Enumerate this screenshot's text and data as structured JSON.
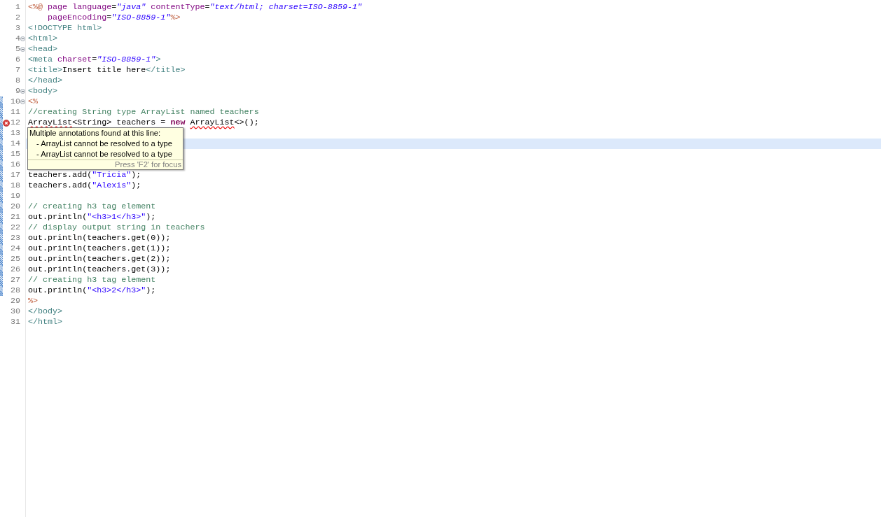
{
  "editor": {
    "lines": [
      {
        "number": "1",
        "fold_marker": false,
        "error": false,
        "changed": false,
        "current": false,
        "tokens": [
          {
            "kind": "delim",
            "text": "<%@"
          },
          {
            "kind": "attr",
            "text": " page language"
          },
          {
            "kind": "plain",
            "text": "="
          },
          {
            "kind": "string",
            "text": "\"java\""
          },
          {
            "kind": "attr",
            "text": " contentType"
          },
          {
            "kind": "plain",
            "text": "="
          },
          {
            "kind": "string",
            "text": "\"text/html; charset=ISO-8859-1\""
          }
        ]
      },
      {
        "number": "2",
        "fold_marker": false,
        "error": false,
        "changed": false,
        "current": false,
        "tokens": [
          {
            "kind": "attr",
            "text": "    pageEncoding"
          },
          {
            "kind": "plain",
            "text": "="
          },
          {
            "kind": "string",
            "text": "\"ISO-8859-1\""
          },
          {
            "kind": "delim",
            "text": "%>"
          }
        ]
      },
      {
        "number": "3",
        "fold_marker": false,
        "error": false,
        "changed": false,
        "current": false,
        "tokens": [
          {
            "kind": "tag",
            "text": "<!DOCTYPE html>"
          }
        ]
      },
      {
        "number": "4",
        "fold_marker": true,
        "error": false,
        "changed": false,
        "current": false,
        "tokens": [
          {
            "kind": "tag",
            "text": "<html>"
          }
        ]
      },
      {
        "number": "5",
        "fold_marker": true,
        "error": false,
        "changed": false,
        "current": false,
        "tokens": [
          {
            "kind": "tag",
            "text": "<head>"
          }
        ]
      },
      {
        "number": "6",
        "fold_marker": false,
        "error": false,
        "changed": false,
        "current": false,
        "tokens": [
          {
            "kind": "tag",
            "text": "<meta"
          },
          {
            "kind": "attr",
            "text": " charset"
          },
          {
            "kind": "plain",
            "text": "="
          },
          {
            "kind": "string",
            "text": "\"ISO-8859-1\""
          },
          {
            "kind": "tag",
            "text": ">"
          }
        ]
      },
      {
        "number": "7",
        "fold_marker": false,
        "error": false,
        "changed": false,
        "current": false,
        "tokens": [
          {
            "kind": "tag",
            "text": "<title>"
          },
          {
            "kind": "plain",
            "text": "Insert title here"
          },
          {
            "kind": "tag",
            "text": "</title>"
          }
        ]
      },
      {
        "number": "8",
        "fold_marker": false,
        "error": false,
        "changed": false,
        "current": false,
        "tokens": [
          {
            "kind": "tag",
            "text": "</head>"
          }
        ]
      },
      {
        "number": "9",
        "fold_marker": true,
        "error": false,
        "changed": false,
        "current": false,
        "tokens": [
          {
            "kind": "tag",
            "text": "<body>"
          }
        ]
      },
      {
        "number": "10",
        "fold_marker": true,
        "error": false,
        "changed": true,
        "current": false,
        "tokens": [
          {
            "kind": "delim",
            "text": "<%"
          }
        ]
      },
      {
        "number": "11",
        "fold_marker": false,
        "error": false,
        "changed": true,
        "current": false,
        "tokens": [
          {
            "kind": "comment",
            "text": "//creating String type ArrayList named teachers"
          }
        ]
      },
      {
        "number": "12",
        "fold_marker": false,
        "error": true,
        "changed": true,
        "current": false,
        "tokens": [
          {
            "kind": "error-type",
            "text": "ArrayList"
          },
          {
            "kind": "plain",
            "text": "<String> teachers = "
          },
          {
            "kind": "keyword",
            "text": "new "
          },
          {
            "kind": "error-type",
            "text": "ArrayList"
          },
          {
            "kind": "plain",
            "text": "<>();"
          }
        ]
      },
      {
        "number": "13",
        "fold_marker": false,
        "error": false,
        "changed": true,
        "current": false
      },
      {
        "number": "14",
        "fold_marker": false,
        "error": false,
        "changed": true,
        "current": true
      },
      {
        "number": "15",
        "fold_marker": false,
        "error": false,
        "changed": true,
        "current": false
      },
      {
        "number": "16",
        "fold_marker": false,
        "error": false,
        "changed": true,
        "current": false
      },
      {
        "number": "17",
        "fold_marker": false,
        "error": false,
        "changed": true,
        "current": false,
        "tokens": [
          {
            "kind": "plain",
            "text": "teachers.add("
          },
          {
            "kind": "jstring",
            "text": "\"Tricia\""
          },
          {
            "kind": "plain",
            "text": ");"
          }
        ]
      },
      {
        "number": "18",
        "fold_marker": false,
        "error": false,
        "changed": true,
        "current": false,
        "tokens": [
          {
            "kind": "plain",
            "text": "teachers.add("
          },
          {
            "kind": "jstring",
            "text": "\"Alexis\""
          },
          {
            "kind": "plain",
            "text": ");"
          }
        ]
      },
      {
        "number": "19",
        "fold_marker": false,
        "error": false,
        "changed": true,
        "current": false
      },
      {
        "number": "20",
        "fold_marker": false,
        "error": false,
        "changed": true,
        "current": false,
        "tokens": [
          {
            "kind": "comment",
            "text": "// creating h3 tag element"
          }
        ]
      },
      {
        "number": "21",
        "fold_marker": false,
        "error": false,
        "changed": true,
        "current": false,
        "tokens": [
          {
            "kind": "plain",
            "text": "out.println("
          },
          {
            "kind": "jstring",
            "text": "\"<h3>1</h3>\""
          },
          {
            "kind": "plain",
            "text": ");"
          }
        ]
      },
      {
        "number": "22",
        "fold_marker": false,
        "error": false,
        "changed": true,
        "current": false,
        "tokens": [
          {
            "kind": "comment",
            "text": "// display output string in teachers"
          }
        ]
      },
      {
        "number": "23",
        "fold_marker": false,
        "error": false,
        "changed": true,
        "current": false,
        "tokens": [
          {
            "kind": "plain",
            "text": "out.println(teachers.get(0));"
          }
        ]
      },
      {
        "number": "24",
        "fold_marker": false,
        "error": false,
        "changed": true,
        "current": false,
        "tokens": [
          {
            "kind": "plain",
            "text": "out.println(teachers.get(1));"
          }
        ]
      },
      {
        "number": "25",
        "fold_marker": false,
        "error": false,
        "changed": true,
        "current": false,
        "tokens": [
          {
            "kind": "plain",
            "text": "out.println(teachers.get(2));"
          }
        ]
      },
      {
        "number": "26",
        "fold_marker": false,
        "error": false,
        "changed": true,
        "current": false,
        "tokens": [
          {
            "kind": "plain",
            "text": "out.println(teachers.get(3));"
          }
        ]
      },
      {
        "number": "27",
        "fold_marker": false,
        "error": false,
        "changed": true,
        "current": false,
        "tokens": [
          {
            "kind": "comment",
            "text": "// creating h3 tag element"
          }
        ]
      },
      {
        "number": "28",
        "fold_marker": false,
        "error": false,
        "changed": true,
        "current": false,
        "tokens": [
          {
            "kind": "plain",
            "text": "out.println("
          },
          {
            "kind": "jstring",
            "text": "\"<h3>2</h3>\""
          },
          {
            "kind": "plain",
            "text": ");"
          }
        ]
      },
      {
        "number": "29",
        "fold_marker": false,
        "error": false,
        "changed": false,
        "current": false,
        "tokens": [
          {
            "kind": "delim",
            "text": "%>"
          }
        ]
      },
      {
        "number": "30",
        "fold_marker": false,
        "error": false,
        "changed": false,
        "current": false,
        "tokens": [
          {
            "kind": "tag",
            "text": "</body>"
          }
        ]
      },
      {
        "number": "31",
        "fold_marker": false,
        "error": false,
        "changed": false,
        "current": false,
        "tokens": [
          {
            "kind": "tag",
            "text": "</html>"
          }
        ]
      }
    ]
  },
  "tooltip": {
    "title": "Multiple annotations found at this line:",
    "items": [
      "- ArrayList cannot be resolved to a type",
      "- ArrayList cannot be resolved to a type"
    ],
    "footer": "Press 'F2' for focus"
  }
}
